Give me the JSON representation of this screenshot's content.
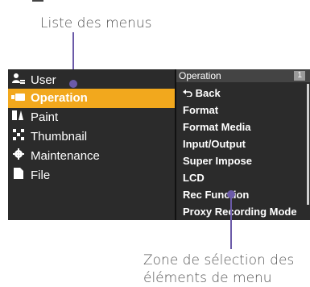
{
  "callouts": {
    "top": "Liste des menus",
    "bottom_line1": "Zone de sélection des",
    "bottom_line2": "éléments de menu"
  },
  "left_menu": {
    "items": [
      {
        "label": "User",
        "icon": "user-icon"
      },
      {
        "label": "Operation",
        "icon": "operation-icon",
        "selected": true
      },
      {
        "label": "Paint",
        "icon": "paint-icon"
      },
      {
        "label": "Thumbnail",
        "icon": "thumbnail-icon"
      },
      {
        "label": "Maintenance",
        "icon": "gear-icon"
      },
      {
        "label": "File",
        "icon": "file-icon"
      }
    ]
  },
  "right_menu": {
    "header_title": "Operation",
    "page_number": "1",
    "items": [
      {
        "label": "Back",
        "icon": "back-arrow-icon"
      },
      {
        "label": "Format"
      },
      {
        "label": "Format Media"
      },
      {
        "label": "Input/Output"
      },
      {
        "label": "Super Impose"
      },
      {
        "label": "LCD"
      },
      {
        "label": "Rec Function"
      },
      {
        "label": "Proxy Recording Mode"
      }
    ]
  },
  "colors": {
    "selected_bg": "#f2a81d",
    "screen_bg": "#2b2b2b",
    "callout_line": "#6b5aa8"
  }
}
